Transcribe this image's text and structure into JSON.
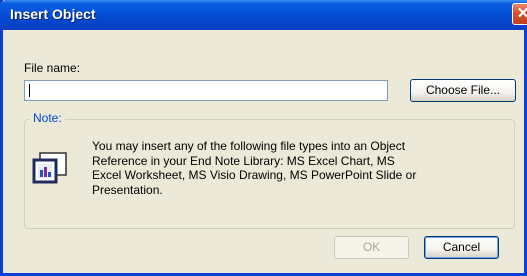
{
  "window": {
    "title": "Insert Object",
    "close_glyph": "✕"
  },
  "form": {
    "file_name_label": "File name:",
    "file_name_value": "",
    "choose_file_label": "Choose File..."
  },
  "note": {
    "legend": "Note:",
    "text": "You may insert any of the following file types into an Object Reference in your End Note Library: MS Excel Chart, MS Excel Worksheet, MS Visio Drawing, MS PowerPoint Slide or Presentation.",
    "icon": "object-chart-icon"
  },
  "buttons": {
    "ok_label": "OK",
    "cancel_label": "Cancel"
  },
  "colors": {
    "titlebar": "#0552d8",
    "face": "#ece9d8",
    "note_legend": "#0046d5",
    "close": "#d8542e"
  }
}
